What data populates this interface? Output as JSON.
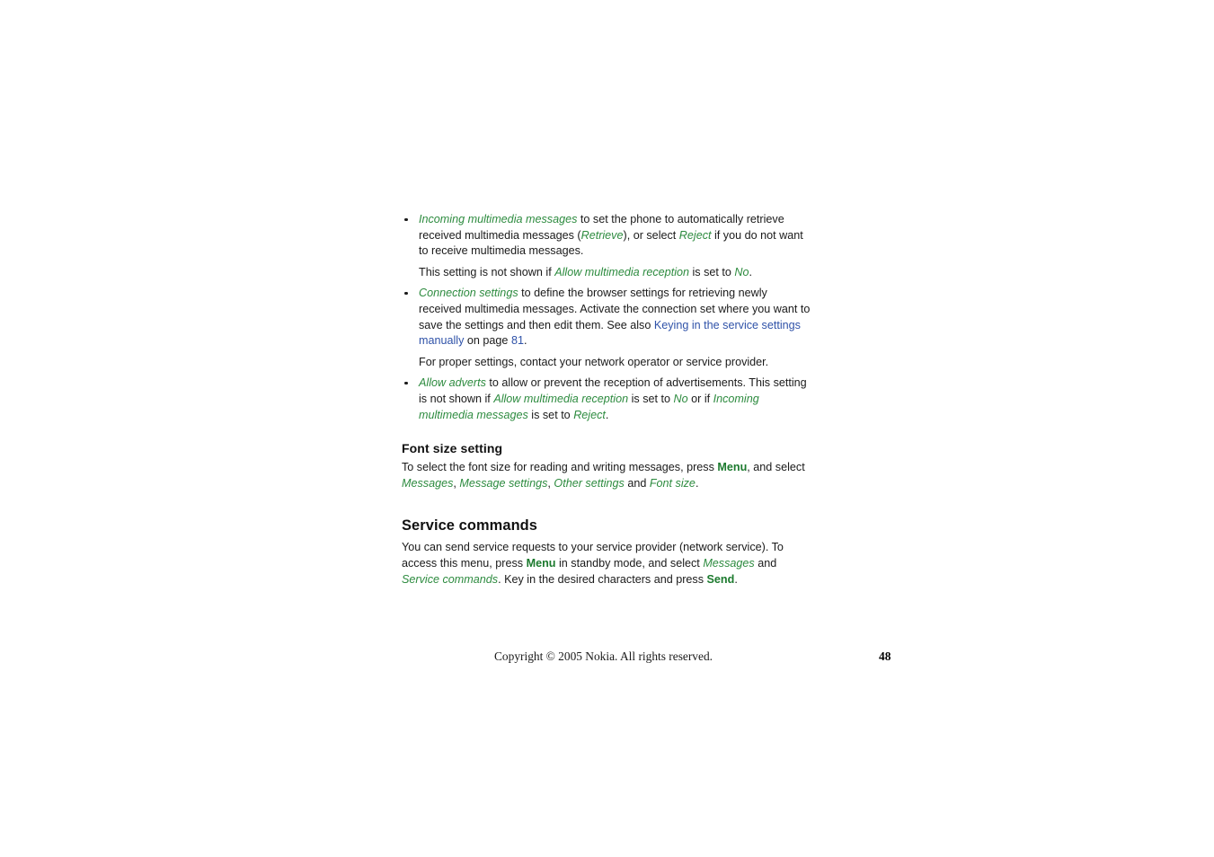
{
  "page": {
    "background_color": "#ffffff",
    "text_color": "#1a1a1a",
    "accent_green": "#2d8b3f",
    "accent_green_bold": "#1c7a2e",
    "link_blue": "#2f52a8"
  },
  "bullets": [
    {
      "marker": "bullet-dot",
      "segments": [
        {
          "text": "Incoming multimedia messages",
          "style": "menu-italic"
        },
        {
          "text": " to set the phone to automatically retrieve received multimedia messages (",
          "style": "plain"
        },
        {
          "text": "Retrieve",
          "style": "menu-italic"
        },
        {
          "text": "), or select ",
          "style": "plain"
        },
        {
          "text": "Reject",
          "style": "menu-italic"
        },
        {
          "text": " if you do not want to receive multimedia messages.",
          "style": "plain"
        }
      ],
      "follow_up": [
        {
          "text": "This setting is not shown if ",
          "style": "plain"
        },
        {
          "text": "Allow multimedia reception",
          "style": "menu-italic"
        },
        {
          "text": " is set to ",
          "style": "plain"
        },
        {
          "text": "No",
          "style": "menu-italic"
        },
        {
          "text": ".",
          "style": "plain"
        }
      ]
    },
    {
      "marker": "bullet-dot",
      "segments": [
        {
          "text": "Connection settings",
          "style": "menu-italic"
        },
        {
          "text": " to define the browser settings for retrieving newly received multimedia messages. Activate the connection set where you want to save the settings and then edit them. See also ",
          "style": "plain"
        },
        {
          "text": "Keying in the service settings manually",
          "style": "link"
        },
        {
          "text": " on page ",
          "style": "plain"
        },
        {
          "text": "81",
          "style": "link"
        },
        {
          "text": ".",
          "style": "plain"
        }
      ],
      "follow_up": [
        {
          "text": "For proper settings, contact your network operator or service provider.",
          "style": "plain"
        }
      ]
    },
    {
      "marker": "bullet-dot",
      "segments": [
        {
          "text": "Allow adverts",
          "style": "menu-italic"
        },
        {
          "text": " to allow or prevent the reception of advertisements. This setting is not shown if ",
          "style": "plain"
        },
        {
          "text": "Allow multimedia reception",
          "style": "menu-italic"
        },
        {
          "text": " is set to ",
          "style": "plain"
        },
        {
          "text": "No",
          "style": "menu-italic"
        },
        {
          "text": " or if ",
          "style": "plain"
        },
        {
          "text": "Incoming multimedia messages",
          "style": "menu-italic"
        },
        {
          "text": " is set to ",
          "style": "plain"
        },
        {
          "text": "Reject",
          "style": "menu-italic"
        },
        {
          "text": ".",
          "style": "plain"
        }
      ],
      "follow_up": []
    }
  ],
  "font_size_section": {
    "heading": "Font size setting",
    "body": [
      {
        "text": "To select the font size for reading and writing messages, press ",
        "style": "plain"
      },
      {
        "text": "Menu",
        "style": "menu-bold"
      },
      {
        "text": ", and select ",
        "style": "plain"
      },
      {
        "text": "Messages",
        "style": "menu-italic"
      },
      {
        "text": ", ",
        "style": "plain"
      },
      {
        "text": "Message settings",
        "style": "menu-italic"
      },
      {
        "text": ", ",
        "style": "plain"
      },
      {
        "text": "Other settings",
        "style": "menu-italic"
      },
      {
        "text": " and ",
        "style": "plain"
      },
      {
        "text": "Font size",
        "style": "menu-italic"
      },
      {
        "text": ".",
        "style": "plain"
      }
    ]
  },
  "service_commands_section": {
    "heading": "Service commands",
    "body": [
      {
        "text": "You can send service requests to your service provider (network service). To access this menu, press ",
        "style": "plain"
      },
      {
        "text": "Menu",
        "style": "menu-bold"
      },
      {
        "text": " in standby mode, and select ",
        "style": "plain"
      },
      {
        "text": "Messages",
        "style": "menu-italic"
      },
      {
        "text": " and ",
        "style": "plain"
      },
      {
        "text": "Service commands",
        "style": "menu-italic"
      },
      {
        "text": ". Key in the desired characters and press ",
        "style": "plain"
      },
      {
        "text": "Send",
        "style": "menu-bold"
      },
      {
        "text": ".",
        "style": "plain"
      }
    ]
  },
  "footer": {
    "copyright": "Copyright © 2005 Nokia. All rights reserved.",
    "page_number": "48"
  }
}
